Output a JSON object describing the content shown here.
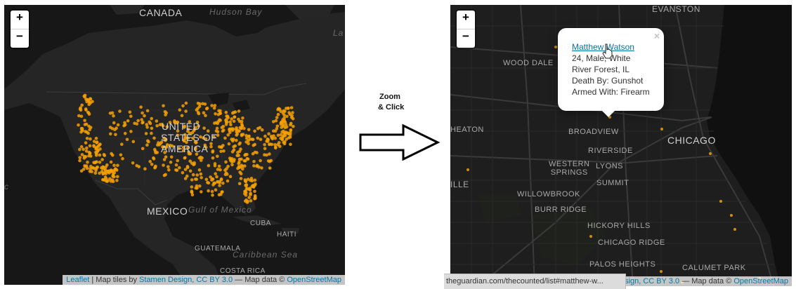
{
  "left_map": {
    "zoom_in": "+",
    "zoom_out": "−",
    "labels": {
      "canada": "CANADA",
      "hudson_bay": "Hudson Bay",
      "la": "La",
      "usa_1": "UNITED",
      "usa_2": "STATES OF",
      "usa_3": "AMERICA",
      "mexico": "MEXICO",
      "gulf": "Gulf of Mexico",
      "cuba": "CUBA",
      "haiti": "HAITI",
      "guatemala": "GUATEMALA",
      "caribbean": "Caribbean Sea",
      "costa_rica": "COSTA RICA",
      "edge": "c"
    },
    "attribution": {
      "leaflet": "Leaflet",
      "sep1": " | Map tiles by ",
      "stamen": "Stamen Design, CC BY 3.0",
      "sep2": " — Map data © ",
      "osm": "OpenStreetMap"
    },
    "dot_color": "#f5a000"
  },
  "arrow_caption": {
    "line1": "Zoom",
    "line2": "& Click"
  },
  "right_map": {
    "zoom_in": "+",
    "zoom_out": "−",
    "labels": {
      "evanston": "EVANSTON",
      "wood_dale": "WOOD DALE",
      "heaton": "HEATON",
      "broadview": "BROADVIEW",
      "chicago": "CHICAGO",
      "riverside": "RIVERSIDE",
      "western_springs_1": "WESTERN",
      "western_springs_2": "SPRINGS",
      "lyons": "LYONS",
      "ille": "ILLE",
      "summit": "SUMMIT",
      "willowbrook": "WILLOWBROOK",
      "burr_ridge": "BURR RIDGE",
      "hickory_hills": "HICKORY HILLS",
      "chicago_ridge": "CHICAGO RIDGE",
      "palos_heights": "PALOS HEIGHTS",
      "calumet_park": "CALUMET PARK"
    },
    "popup": {
      "name": "Matthew Watson",
      "line1": "24, Male, White",
      "line2": "River Forest, IL",
      "line3": "Death By: Gunshot",
      "line4": "Armed With: Firearm",
      "close": "×"
    },
    "attribution": {
      "stamen": "esign, CC BY 3.0",
      "sep2": " — Map data © ",
      "osm": "OpenStreetMap"
    },
    "status_url": "theguardian.com/thecounted/list#matthew-w..."
  }
}
